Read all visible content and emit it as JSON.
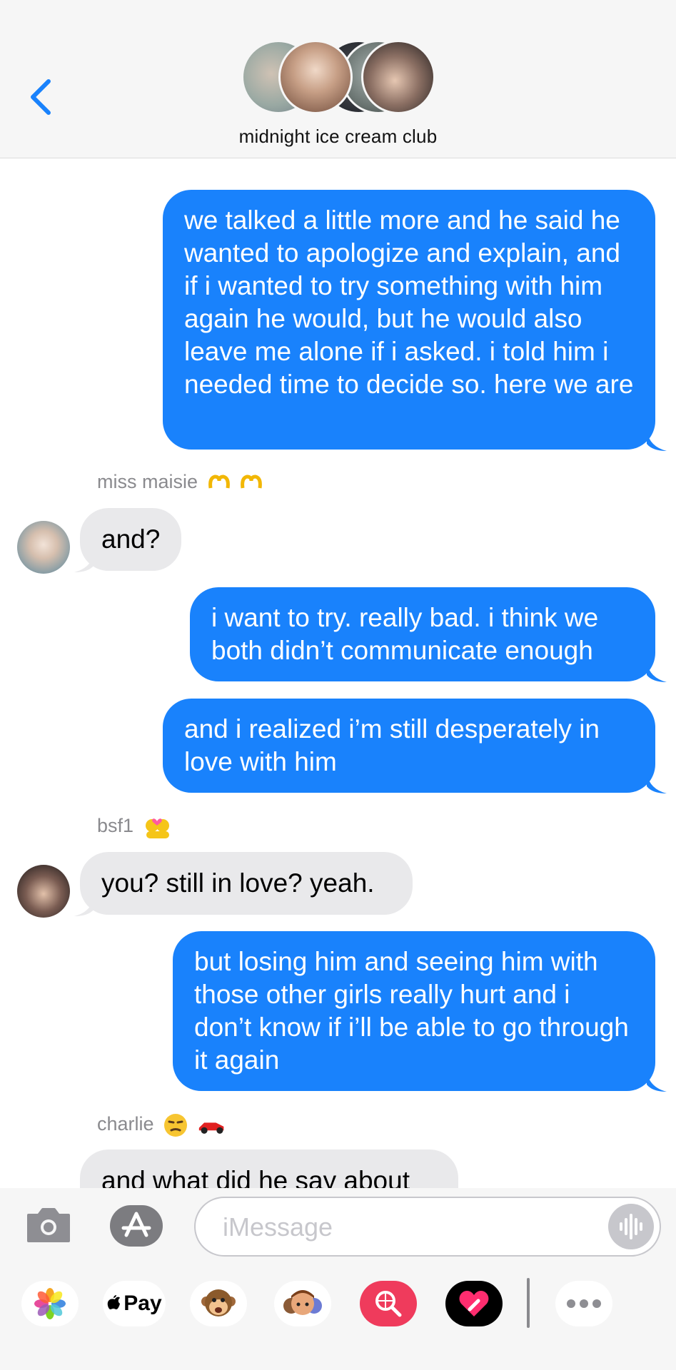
{
  "header": {
    "group_name": "midnight ice cream club",
    "back_icon": "chevron-left-icon"
  },
  "messages": [
    {
      "type": "sent",
      "text": "we talked a little more and he said he wanted to apologize and explain, and if i wanted to try something with him again he would, but he would also leave me alone if i asked. i told him i needed time to decide so. here we are"
    },
    {
      "type": "label",
      "text": "miss maisie"
    },
    {
      "type": "recv",
      "text": "and?"
    },
    {
      "type": "sent",
      "text": "i want to try. really bad. i think we both didn’t communicate enough"
    },
    {
      "type": "sent",
      "text": "and i realized i’m still desperately in love with him"
    },
    {
      "type": "label",
      "text": "bsf1"
    },
    {
      "type": "recv",
      "text": "you? still in love? yeah."
    },
    {
      "type": "sent",
      "text": "but losing him and seeing him with those other girls really hurt and i don’t know if i’ll be able to go through it again"
    },
    {
      "type": "label",
      "text": "charlie"
    },
    {
      "type": "recv",
      "text": "and what did he say about"
    }
  ],
  "input": {
    "placeholder": "iMessage"
  },
  "app_drawer": {
    "pay_label": "Pay",
    "items": [
      "photos-icon",
      "apple-pay-icon",
      "animoji-icon",
      "memoji-icon",
      "search-images-icon",
      "digital-touch-icon",
      "more-icon"
    ]
  },
  "colors": {
    "sent_bubble": "#1982fc",
    "received_bubble": "#e9e9eb",
    "accent": "#1982fc"
  }
}
